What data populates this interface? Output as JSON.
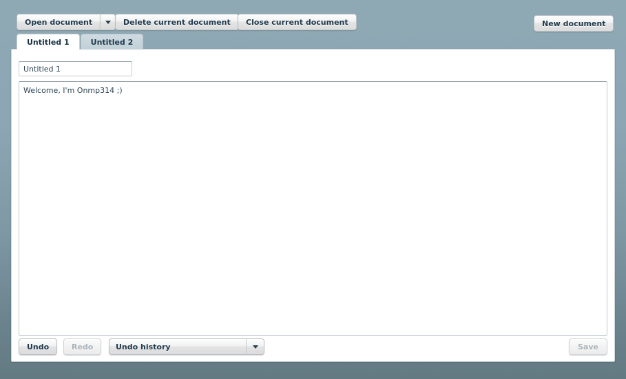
{
  "toolbar": {
    "open_document_label": "Open document",
    "open_document_arrow_icon": "chevron-down-icon",
    "delete_current_document_label": "Delete current document",
    "close_current_document_label": "Close current document",
    "new_document_label": "New document"
  },
  "tabs": [
    {
      "label": "Untitled 1",
      "active": true
    },
    {
      "label": "Untitled 2",
      "active": false
    }
  ],
  "document": {
    "title_value": "Untitled 1",
    "title_placeholder": "Untitled 1",
    "body_value": "Welcome, I'm Onmp314 ;)",
    "body_placeholder": ""
  },
  "bottombar": {
    "undo_label": "Undo",
    "redo_label": "Redo",
    "redo_disabled": true,
    "history_select_label": "Undo history",
    "history_select_arrow_icon": "chevron-down-icon",
    "save_label": "Save",
    "save_disabled": true
  },
  "colors": {
    "page_background_top": "#8ea8b4",
    "page_background_bottom": "#637a82",
    "panel_background": "#ffffff",
    "text_primary": "#1f3a4d",
    "text_disabled": "#a9b3b8",
    "tab_inactive": "#c6d3da",
    "input_border": "#c3cbd0"
  }
}
